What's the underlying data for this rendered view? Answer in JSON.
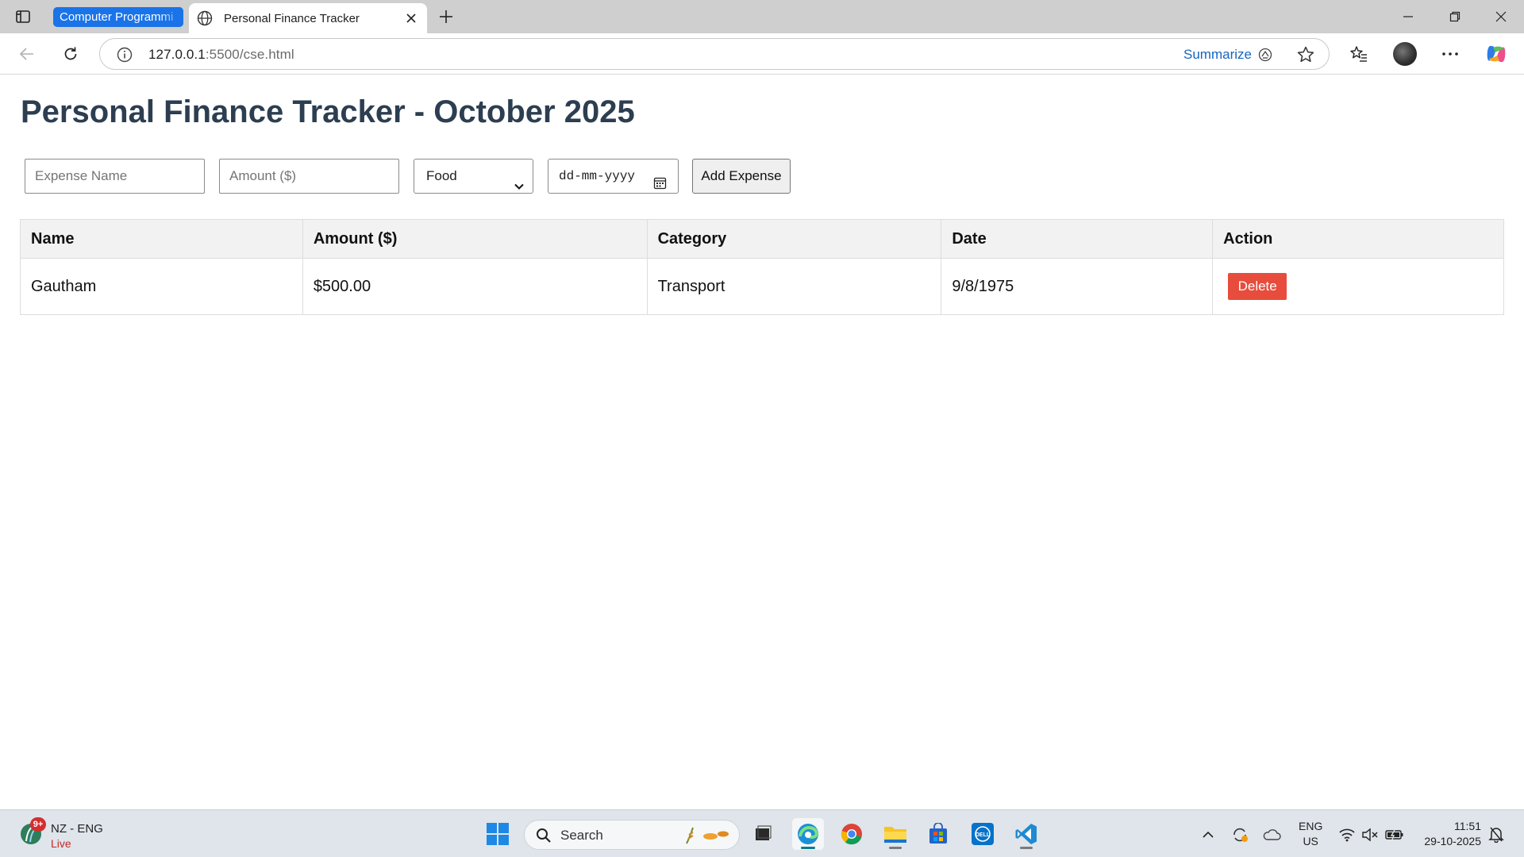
{
  "browser": {
    "tab_group_label": "Computer Programmi",
    "active_tab_title": "Personal Finance Tracker",
    "url_host": "127.0.0.1",
    "url_rest": ":5500/cse.html",
    "summarize_label": "Summarize"
  },
  "page": {
    "heading": "Personal Finance Tracker - October 2025",
    "form": {
      "expense_name_placeholder": "Expense Name",
      "amount_placeholder": "Amount ($)",
      "category_selected": "Food",
      "date_placeholder": "dd-mm-yyyy",
      "add_button_label": "Add Expense"
    },
    "table": {
      "headers": [
        "Name",
        "Amount ($)",
        "Category",
        "Date",
        "Action"
      ],
      "rows": [
        {
          "name": "Gautham",
          "amount": "$500.00",
          "category": "Transport",
          "date": "9/8/1975",
          "action_label": "Delete"
        }
      ]
    }
  },
  "taskbar": {
    "weather_badge": "9+",
    "weather_title": "NZ - ENG",
    "weather_live": "Live",
    "search_label": "Search",
    "lang_line1": "ENG",
    "lang_line2": "US",
    "time": "11:51",
    "date": "29-10-2025"
  },
  "colors": {
    "heading": "#2c3e50",
    "delete_button": "#e74c3c",
    "tab_group": "#1a73e8",
    "summarize_link": "#1565c0"
  }
}
